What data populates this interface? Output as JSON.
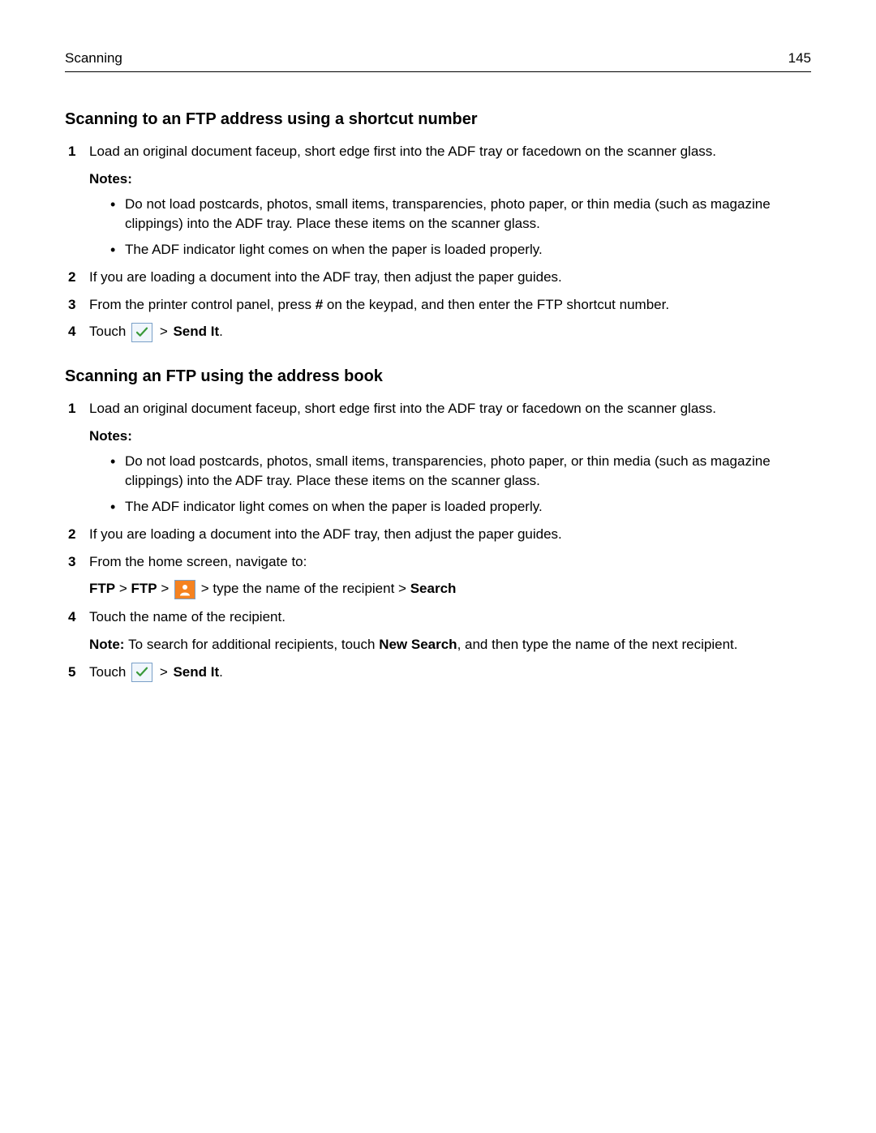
{
  "header": {
    "left": "Scanning",
    "right": "145"
  },
  "sec1": {
    "title": "Scanning to an FTP address using a shortcut number",
    "s1": {
      "num": "1",
      "text": "Load an original document faceup, short edge first into the ADF tray or facedown on the scanner glass."
    },
    "notes_label": "Notes:",
    "b1": "Do not load postcards, photos, small items, transparencies, photo paper, or thin media (such as magazine clippings) into the ADF tray. Place these items on the scanner glass.",
    "b2": "The ADF indicator light comes on when the paper is loaded properly.",
    "s2": {
      "num": "2",
      "text": "If you are loading a document into the ADF tray, then adjust the paper guides."
    },
    "s3": {
      "num": "3",
      "pre": "From the printer control panel, press ",
      "hash": "#",
      "post": " on the keypad, and then enter the FTP shortcut number."
    },
    "s4": {
      "num": "4",
      "touch": "Touch ",
      "gt": " > ",
      "sendit": "Send It",
      "dot": "."
    }
  },
  "sec2": {
    "title": "Scanning an FTP using the address book",
    "s1": {
      "num": "1",
      "text": "Load an original document faceup, short edge first into the ADF tray or facedown on the scanner glass."
    },
    "notes_label": "Notes:",
    "b1": "Do not load postcards, photos, small items, transparencies, photo paper, or thin media (such as magazine clippings) into the ADF tray. Place these items on the scanner glass.",
    "b2": "The ADF indicator light comes on when the paper is loaded properly.",
    "s2": {
      "num": "2",
      "text": "If you are loading a document into the ADF tray, then adjust the paper guides."
    },
    "s3": {
      "num": "3",
      "text": "From the home screen, navigate to:"
    },
    "nav": {
      "ftp": "FTP",
      "gt": " > ",
      "type": " > type the name of the recipient > ",
      "search": "Search"
    },
    "s4": {
      "num": "4",
      "text": "Touch the name of the recipient."
    },
    "note": {
      "label": "Note: ",
      "pre": "To search for additional recipients, touch ",
      "ns": "New Search",
      "post": ", and then type the name of the next recipient."
    },
    "s5": {
      "num": "5",
      "touch": "Touch ",
      "gt": " > ",
      "sendit": "Send It",
      "dot": "."
    }
  }
}
